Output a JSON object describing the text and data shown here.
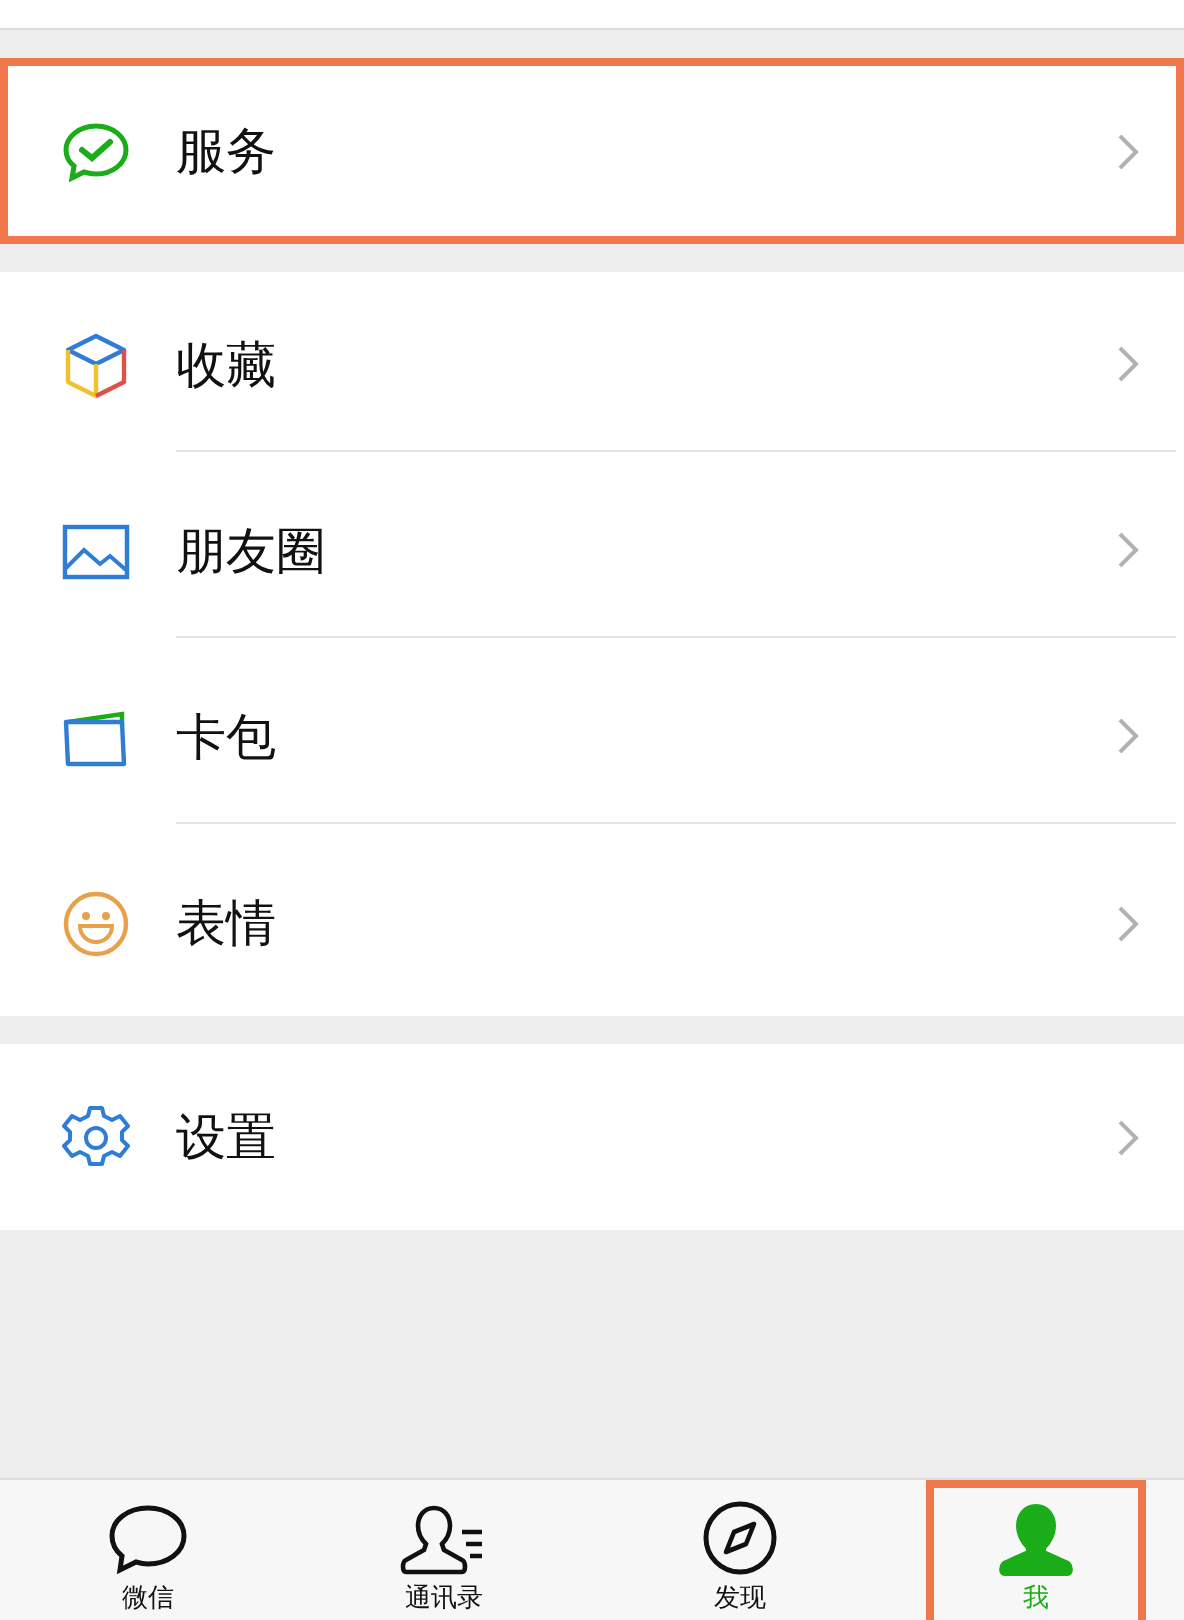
{
  "groups": [
    {
      "items": [
        {
          "label": "服务",
          "kind": "service",
          "highlighted": true
        }
      ]
    },
    {
      "items": [
        {
          "label": "收藏",
          "kind": "favorites",
          "highlighted": false
        },
        {
          "label": "朋友圈",
          "kind": "moments",
          "highlighted": false
        },
        {
          "label": "卡包",
          "kind": "cards",
          "highlighted": false
        },
        {
          "label": "表情",
          "kind": "stickers",
          "highlighted": false
        }
      ]
    },
    {
      "items": [
        {
          "label": "设置",
          "kind": "settings",
          "highlighted": false
        }
      ]
    }
  ],
  "tabs": [
    {
      "label": "微信",
      "kind": "chat",
      "selected": false,
      "highlighted": false
    },
    {
      "label": "通讯录",
      "kind": "contacts",
      "selected": false,
      "highlighted": false
    },
    {
      "label": "发现",
      "kind": "discover",
      "selected": false,
      "highlighted": false
    },
    {
      "label": "我",
      "kind": "me",
      "selected": true,
      "highlighted": true
    }
  ]
}
